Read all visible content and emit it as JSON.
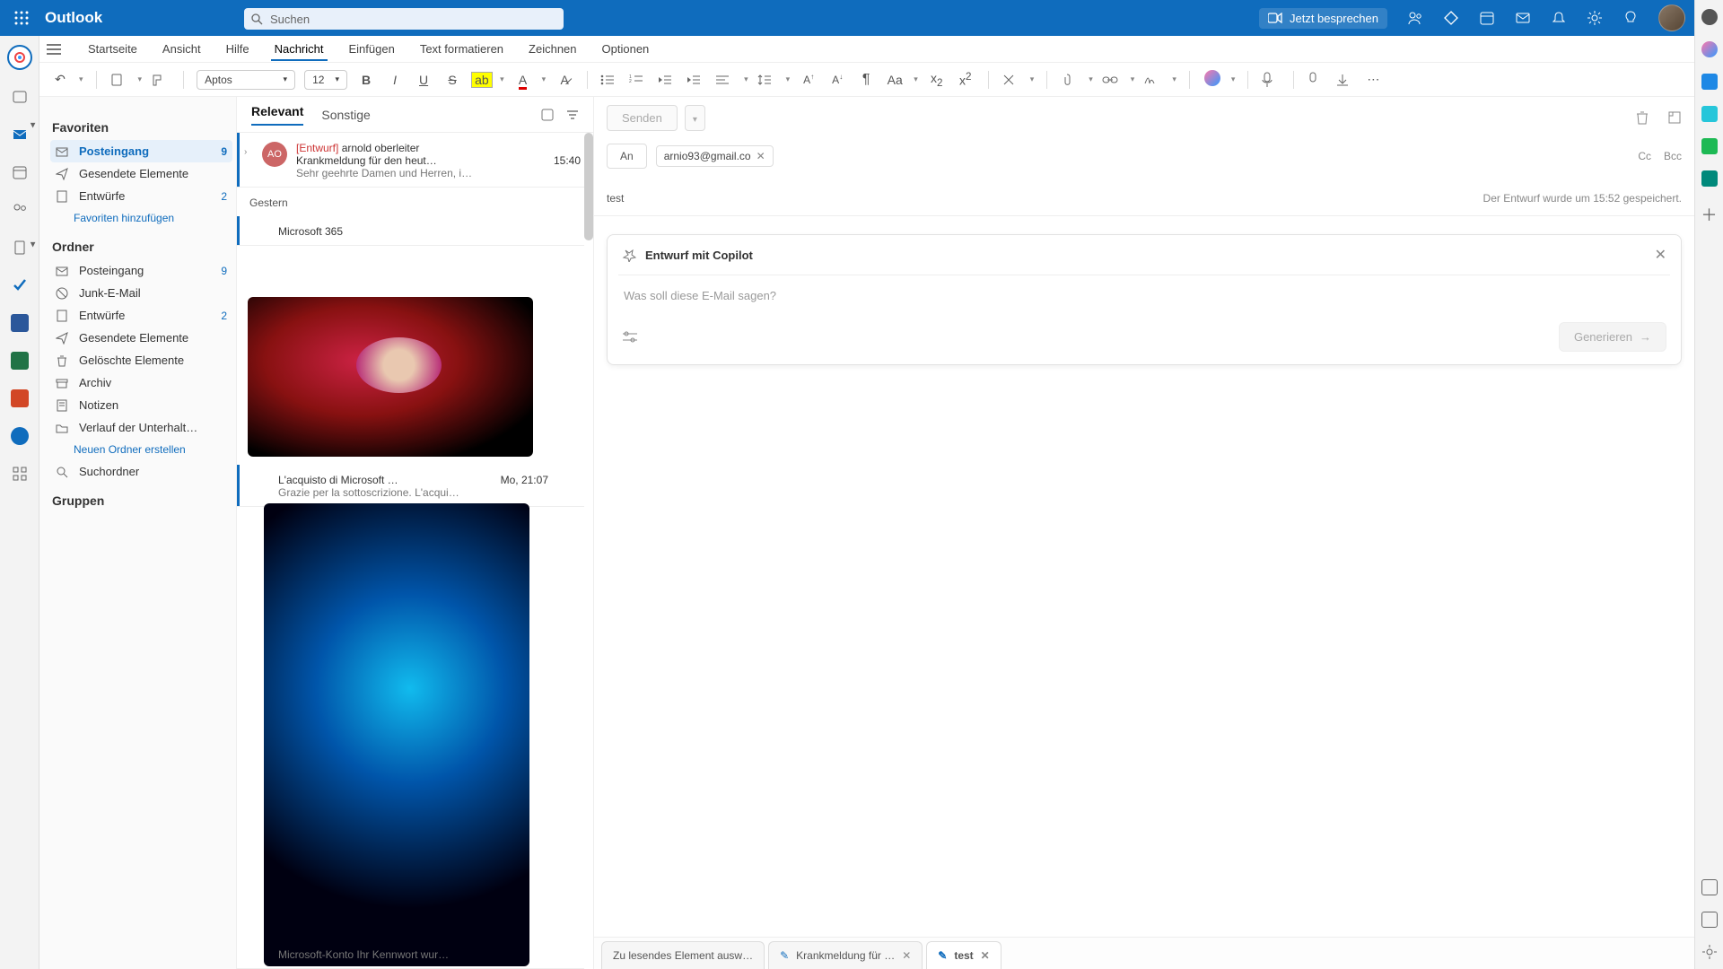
{
  "header": {
    "app_name": "Outlook",
    "search_placeholder": "Suchen",
    "meet_now": "Jetzt besprechen"
  },
  "tabs": {
    "home": "Startseite",
    "view": "Ansicht",
    "help": "Hilfe",
    "message": "Nachricht",
    "insert": "Einfügen",
    "format": "Text formatieren",
    "draw": "Zeichnen",
    "options": "Optionen"
  },
  "format_bar": {
    "font": "Aptos",
    "size": "12"
  },
  "folders": {
    "fav_title": "Favoriten",
    "inbox": "Posteingang",
    "inbox_cnt": "9",
    "sent": "Gesendete Elemente",
    "drafts": "Entwürfe",
    "drafts_cnt": "2",
    "add_fav": "Favoriten hinzufügen",
    "folders_title": "Ordner",
    "junk": "Junk-E-Mail",
    "trash": "Gelöschte Elemente",
    "archive": "Archiv",
    "notes": "Notizen",
    "history": "Verlauf der Unterhalt…",
    "new_folder": "Neuen Ordner erstellen",
    "search_folder": "Suchordner",
    "groups": "Gruppen"
  },
  "msg_tabs": {
    "focused": "Relevant",
    "other": "Sonstige"
  },
  "messages": {
    "m1": {
      "avatar": "AO",
      "tag": "[Entwurf]",
      "from": "arnold oberleiter",
      "subj": "Krankmeldung für den heut…",
      "time": "15:40",
      "snip": "Sehr geehrte Damen und Herren, i…"
    },
    "section_yesterday": "Gestern",
    "m2": {
      "from": "Microsoft 365",
      "subj": "L'acquisto di Microsoft …",
      "time": "Mo, 21:07",
      "snip": "Grazie per la sottoscrizione. L'acqui…"
    },
    "m_bottom": {
      "snip": "Microsoft-Konto Ihr Kennwort wur…"
    }
  },
  "compose": {
    "send": "Senden",
    "to_label": "An",
    "recipient": "arnio93@gmail.co",
    "cc": "Cc",
    "bcc": "Bcc",
    "subject": "test",
    "saved": "Der Entwurf wurde um 15:52 gespeichert."
  },
  "copilot": {
    "title": "Entwurf mit Copilot",
    "placeholder": "Was soll diese E-Mail sagen?",
    "generate": "Generieren"
  },
  "bottom_tabs": {
    "t1": "Zu lesendes Element ausw…",
    "t2": "Krankmeldung für …",
    "t3": "test"
  }
}
